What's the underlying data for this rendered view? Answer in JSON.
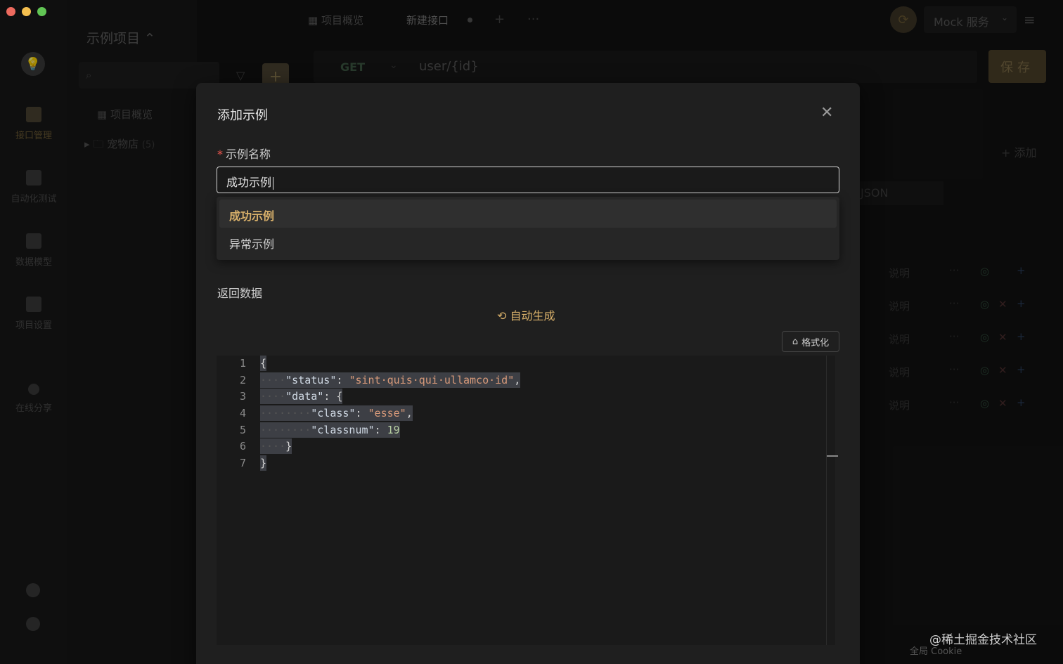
{
  "window": {
    "traffic": [
      "close",
      "minimize",
      "zoom"
    ]
  },
  "rail": {
    "items": [
      {
        "label": "接口管理",
        "icon": "api-icon",
        "active": true
      },
      {
        "label": "自动化测试",
        "icon": "test-icon"
      },
      {
        "label": "数据模型",
        "icon": "model-icon"
      },
      {
        "label": "项目设置",
        "icon": "settings-doc-icon"
      },
      {
        "label": "在线分享",
        "icon": "share-icon"
      }
    ]
  },
  "tree": {
    "project_title": "示例项目 ⌃",
    "overview": "项目概览",
    "folder": "宠物店",
    "folder_count": "(5)"
  },
  "header": {
    "tabs": [
      {
        "label": "项目概览"
      },
      {
        "label": "新建接口"
      }
    ],
    "add_tab": "+",
    "more": "···",
    "mock_service": "Mock 服务"
  },
  "request": {
    "method": "GET",
    "url": "user/{id}",
    "save": "保存"
  },
  "background_panel": {
    "add": "+ 添加",
    "format": "JSON",
    "row_desc": "说明",
    "row_dots": "···"
  },
  "modal": {
    "title": "添加示例",
    "name_label": "示例名称",
    "name_required_mark": "*",
    "name_value": "成功示例",
    "options": [
      "成功示例",
      "异常示例"
    ],
    "response_label": "返回数据",
    "autogen": "自动生成",
    "format_button": "格式化"
  },
  "editor": {
    "line_numbers": [
      "1",
      "2",
      "3",
      "4",
      "5",
      "6",
      "7"
    ],
    "lines": [
      {
        "indent": "",
        "tokens": [
          [
            "p",
            "{"
          ]
        ]
      },
      {
        "indent": "····",
        "tokens": [
          [
            "k",
            "\"status\""
          ],
          [
            "p",
            ": "
          ],
          [
            "s",
            "\"sint·quis·qui·ullamco·id\""
          ],
          [
            "p",
            ","
          ]
        ]
      },
      {
        "indent": "····",
        "tokens": [
          [
            "k",
            "\"data\""
          ],
          [
            "p",
            ": {"
          ]
        ]
      },
      {
        "indent": "········",
        "tokens": [
          [
            "k",
            "\"class\""
          ],
          [
            "p",
            ": "
          ],
          [
            "s",
            "\"esse\""
          ],
          [
            "p",
            ","
          ]
        ]
      },
      {
        "indent": "········",
        "tokens": [
          [
            "k",
            "\"classnum\""
          ],
          [
            "p",
            ": "
          ],
          [
            "n",
            "19"
          ]
        ]
      },
      {
        "indent": "····",
        "tokens": [
          [
            "p",
            "}"
          ]
        ]
      },
      {
        "indent": "",
        "tokens": [
          [
            "p",
            "}"
          ]
        ]
      }
    ]
  },
  "footer": {
    "watermark": "@稀土掘金技术社区",
    "cookie": "全局 Cookie"
  },
  "colors": {
    "accent": "#d8b06a",
    "required": "#e5534b",
    "modal_bg": "#1f1f1f"
  }
}
